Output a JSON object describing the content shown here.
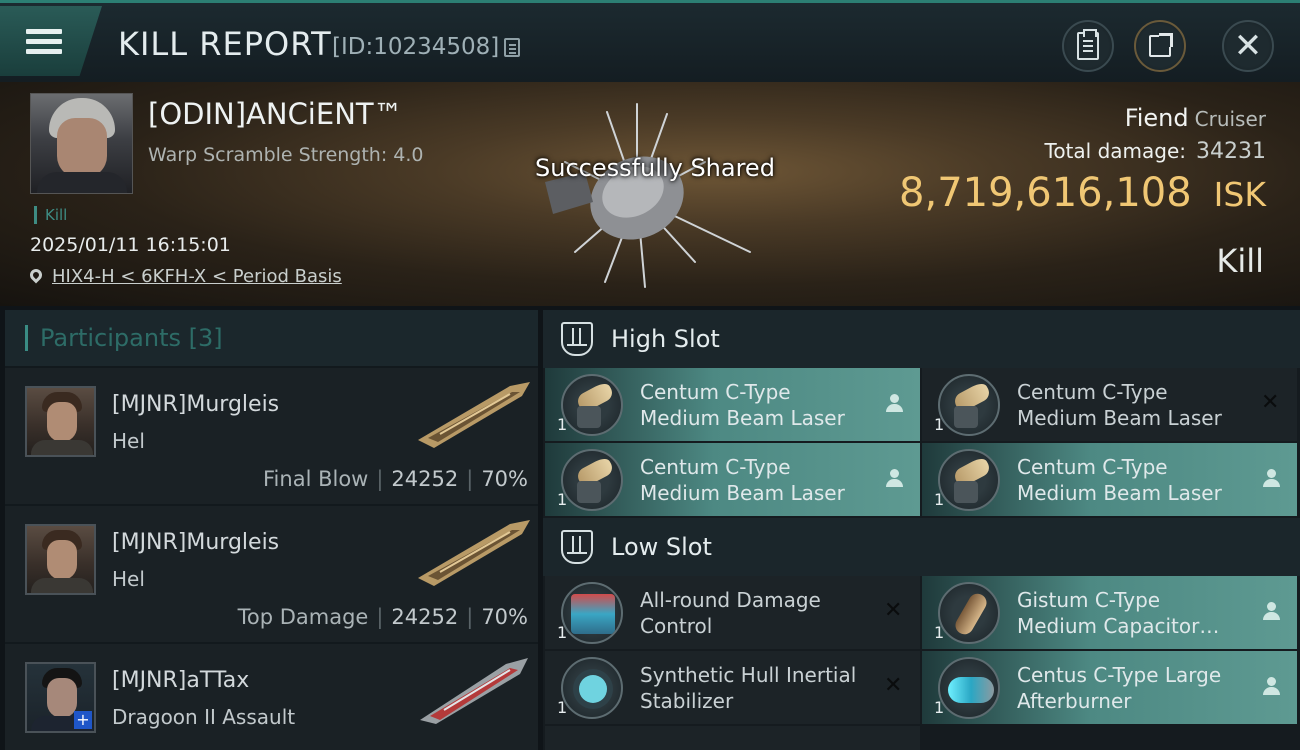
{
  "header": {
    "title": "KILL REPORT",
    "report_id": "[ID:10234508]"
  },
  "victim": {
    "name": "[ODIN]ANCiENT™",
    "subtitle": "Warp Scramble Strength: 4.0",
    "tag": "Kill",
    "datetime": "2025/01/11 16:15:01",
    "location": "HIX4-H < 6KFH-X < Period Basis"
  },
  "toast": "Successfully Shared",
  "ship": {
    "name": "Fiend",
    "class": "Cruiser",
    "total_damage_label": "Total damage:",
    "total_damage": "34231",
    "isk_value": "8,719,616,108",
    "isk_unit": "ISK",
    "result": "Kill"
  },
  "participants": {
    "title": "Participants",
    "count": "[3]",
    "rows": [
      {
        "name": "[MJNR]Murgleis",
        "ship": "Hel",
        "label": "Final Blow",
        "damage": "24252",
        "percent": "70%"
      },
      {
        "name": "[MJNR]Murgleis",
        "ship": "Hel",
        "label": "Top Damage",
        "damage": "24252",
        "percent": "70%"
      },
      {
        "name": "[MJNR]aTTax",
        "ship": "Dragoon II Assault"
      }
    ]
  },
  "slots": {
    "high": {
      "title": "High Slot",
      "items": [
        {
          "line1": "Centum C-Type",
          "line2": "Medium Beam Laser",
          "qty": "1",
          "icon": "laser-icon",
          "status": "user-icon"
        },
        {
          "line1": "Centum C-Type",
          "line2": "Medium Beam Laser",
          "qty": "1",
          "icon": "laser-icon",
          "status": "close-icon"
        },
        {
          "line1": "Centum C-Type",
          "line2": "Medium Beam Laser",
          "qty": "1",
          "icon": "laser-icon",
          "status": "user-icon"
        },
        {
          "line1": "Centum C-Type",
          "line2": "Medium Beam Laser",
          "qty": "1",
          "icon": "laser-icon",
          "status": "user-icon"
        }
      ]
    },
    "low": {
      "title": "Low Slot",
      "items": [
        {
          "line1": "All-round Damage",
          "line2": "Control",
          "qty": "1",
          "icon": "damage-control-icon",
          "status": "close-icon"
        },
        {
          "line1": "Gistum C-Type",
          "line2": "Medium Capacitor…",
          "qty": "1",
          "icon": "capacitor-icon",
          "status": "user-icon"
        },
        {
          "line1": "Synthetic Hull Inertial",
          "line2": "Stabilizer",
          "qty": "1",
          "icon": "stabilizer-icon",
          "status": "close-icon"
        },
        {
          "line1": "Centus C-Type Large",
          "line2": "Afterburner",
          "qty": "1",
          "icon": "afterburner-icon",
          "status": "user-icon"
        }
      ]
    }
  },
  "colors": {
    "accent": "#2c7f74",
    "isk": "#f0c774",
    "module_active": "#5e9a92"
  }
}
